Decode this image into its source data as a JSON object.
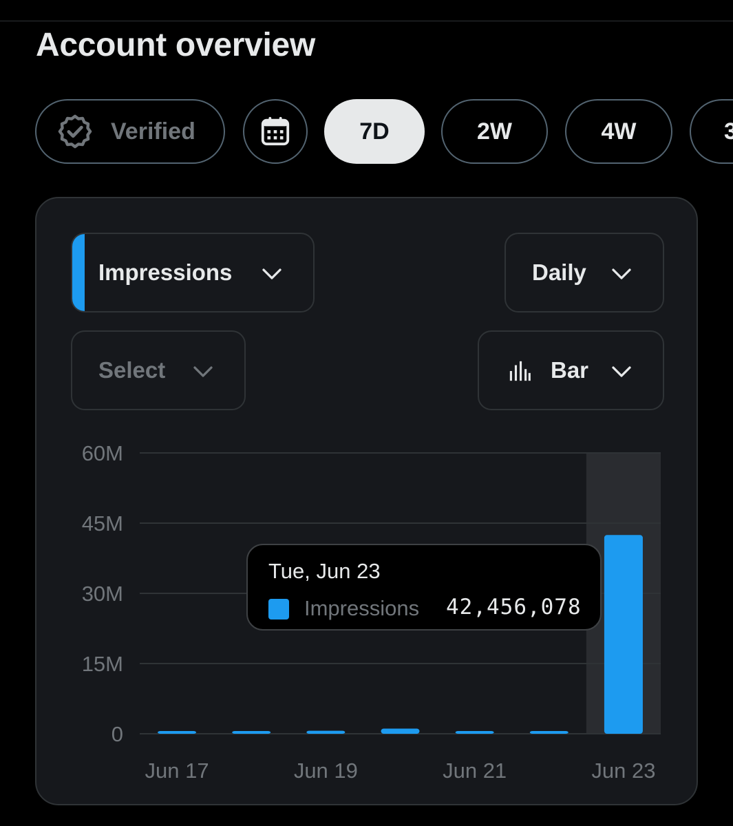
{
  "page": {
    "title": "Account overview"
  },
  "filters": {
    "verified_label": "Verified",
    "periods": [
      {
        "label": "7D",
        "active": true
      },
      {
        "label": "2W",
        "active": false
      },
      {
        "label": "4W",
        "active": false
      },
      {
        "label": "3",
        "active": false
      }
    ]
  },
  "controls": {
    "metric": "Impressions",
    "interval": "Daily",
    "compare_placeholder": "Select",
    "chart_type": "Bar"
  },
  "tooltip": {
    "date": "Tue, Jun 23",
    "series_name": "Impressions",
    "value": "42,456,078"
  },
  "colors": {
    "accent": "#1d9bf0",
    "background": "#000000",
    "card": "#16181c",
    "border": "#2f3336",
    "muted_text": "#71767b",
    "highlight_column": "#2a2c30"
  },
  "chart_data": {
    "type": "bar",
    "categories": [
      "Jun 17",
      "Jun 18",
      "Jun 19",
      "Jun 20",
      "Jun 21",
      "Jun 22",
      "Jun 23"
    ],
    "tick_labels": [
      "Jun 17",
      "Jun 19",
      "Jun 21",
      "Jun 23"
    ],
    "series": [
      {
        "name": "Impressions",
        "values": [
          300000,
          350000,
          650000,
          1100000,
          300000,
          250000,
          42456078
        ]
      }
    ],
    "ylim": [
      0,
      60000000
    ],
    "yticks": [
      0,
      15000000,
      30000000,
      45000000,
      60000000
    ],
    "ytick_labels": [
      "0",
      "15M",
      "30M",
      "45M",
      "60M"
    ],
    "grid": true,
    "highlighted_category": "Jun 23"
  }
}
